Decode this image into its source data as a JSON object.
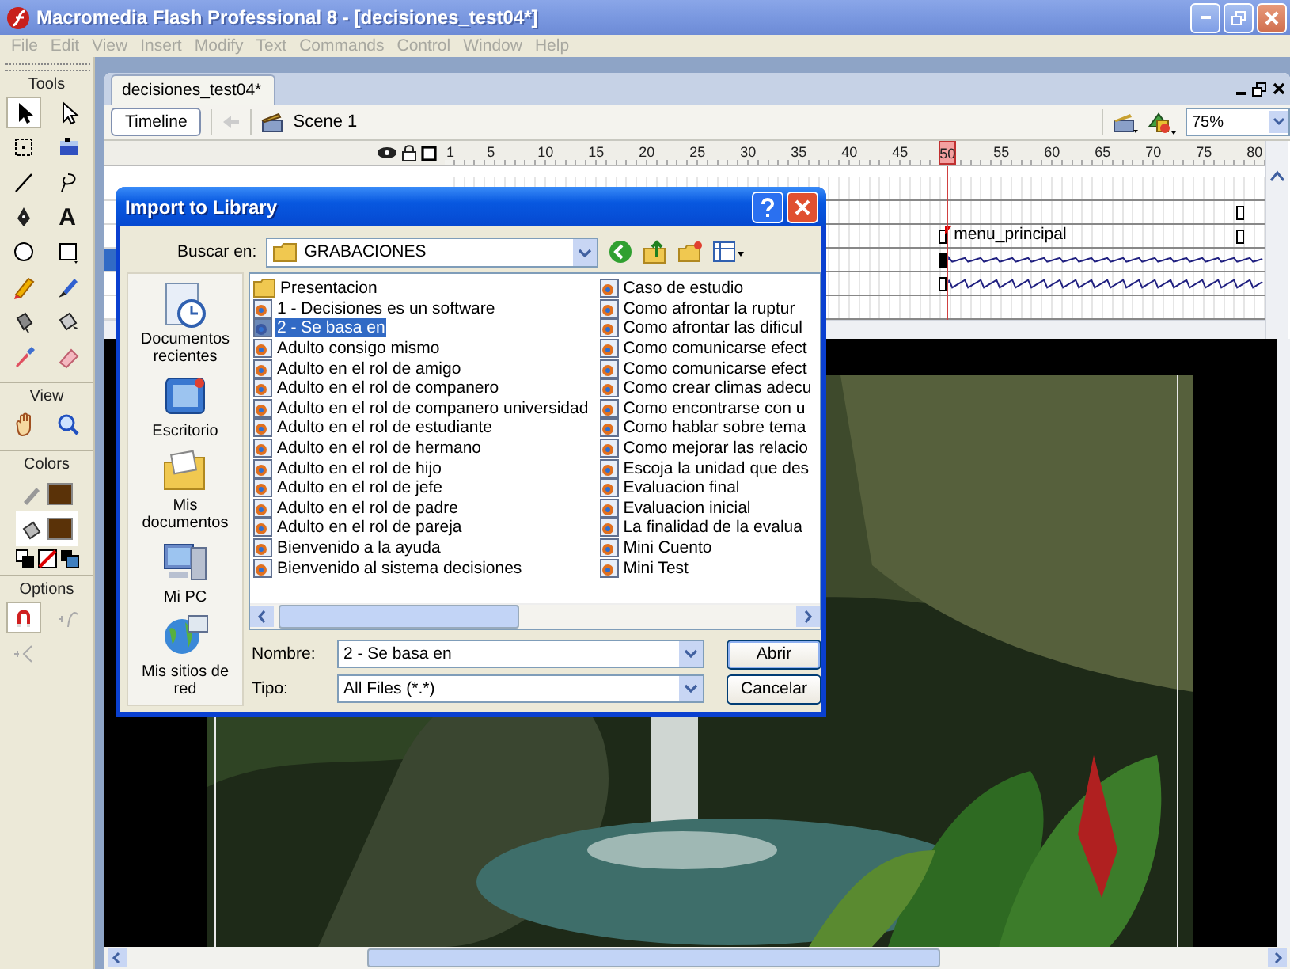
{
  "window": {
    "title": "Macromedia Flash Professional 8 - [decisiones_test04*]"
  },
  "menu": [
    {
      "label": "File",
      "disabled": true
    },
    {
      "label": "Edit",
      "disabled": true
    },
    {
      "label": "View",
      "disabled": true
    },
    {
      "label": "Insert",
      "disabled": true
    },
    {
      "label": "Modify",
      "disabled": true
    },
    {
      "label": "Text",
      "disabled": true
    },
    {
      "label": "Commands",
      "disabled": true
    },
    {
      "label": "Control",
      "disabled": true
    },
    {
      "label": "Window",
      "disabled": true
    },
    {
      "label": "Help",
      "disabled": true
    }
  ],
  "tools": {
    "title": "Tools",
    "items": [
      {
        "kind": "arrow",
        "selected": true
      },
      {
        "kind": "subselect",
        "selected": false
      },
      {
        "kind": "free-transform",
        "selected": false
      },
      {
        "kind": "gradient-transform",
        "selected": false
      },
      {
        "kind": "line",
        "selected": false
      },
      {
        "kind": "lasso",
        "selected": false
      },
      {
        "kind": "pen",
        "selected": false
      },
      {
        "kind": "text",
        "glyph": "A",
        "selected": false
      },
      {
        "kind": "oval",
        "selected": false
      },
      {
        "kind": "rectangle",
        "selected": false
      },
      {
        "kind": "pencil",
        "selected": false
      },
      {
        "kind": "brush",
        "selected": false
      },
      {
        "kind": "ink-bottle",
        "selected": false
      },
      {
        "kind": "paint-bucket",
        "selected": false
      },
      {
        "kind": "eyedropper",
        "selected": false
      },
      {
        "kind": "eraser",
        "selected": false
      }
    ],
    "view_label": "View",
    "view_items": [
      {
        "kind": "hand"
      },
      {
        "kind": "zoom"
      }
    ],
    "colors_label": "Colors",
    "options_label": "Options",
    "options": [
      {
        "kind": "snap",
        "selected": true,
        "disabled": false
      },
      {
        "kind": "smooth",
        "selected": false,
        "disabled": true
      },
      {
        "kind": "straighten",
        "selected": false,
        "disabled": true
      }
    ]
  },
  "document": {
    "tab": "decisiones_test04*",
    "timeline_button": "Timeline",
    "scene": "Scene 1",
    "zoom": "75%"
  },
  "timeline": {
    "ticks": [
      {
        "label": "1",
        "selected": false
      },
      {
        "label": "5",
        "selected": false
      },
      {
        "label": "10",
        "selected": false
      },
      {
        "label": "15",
        "selected": false
      },
      {
        "label": "20",
        "selected": false
      },
      {
        "label": "25",
        "selected": false
      },
      {
        "label": "30",
        "selected": false
      },
      {
        "label": "35",
        "selected": false
      },
      {
        "label": "40",
        "selected": false
      },
      {
        "label": "45",
        "selected": false
      },
      {
        "label": "50",
        "selected": true
      },
      {
        "label": "55",
        "selected": false
      },
      {
        "label": "60",
        "selected": false
      },
      {
        "label": "65",
        "selected": false
      },
      {
        "label": "70",
        "selected": false
      },
      {
        "label": "75",
        "selected": false
      },
      {
        "label": "80",
        "selected": false
      }
    ],
    "layers": [
      {
        "kind": "empty",
        "selected": false
      },
      {
        "kind": "end",
        "selected": false
      },
      {
        "kind": "label",
        "label": "menu_principal",
        "selected": false
      },
      {
        "kind": "sound",
        "selected": true
      },
      {
        "kind": "sound",
        "selected": false
      },
      {
        "kind": "empty",
        "selected": false
      }
    ]
  },
  "dialog": {
    "title": "Import to Library",
    "look_in_label": "Buscar en:",
    "look_in": "GRABACIONES",
    "places": [
      {
        "kind": "recent",
        "label": "Documentos recientes"
      },
      {
        "kind": "desktop",
        "label": "Escritorio"
      },
      {
        "kind": "documents",
        "label": "Mis documentos"
      },
      {
        "kind": "computer",
        "label": "Mi PC"
      },
      {
        "kind": "network",
        "label": "Mis sitios de red"
      }
    ],
    "files": [
      {
        "name": "Presentacion",
        "kind": "folder",
        "selected": false
      },
      {
        "name": "1 - Decisiones es un software",
        "kind": "flash",
        "selected": false
      },
      {
        "name": "2 - Se basa en",
        "kind": "flash",
        "selected": true
      },
      {
        "name": "Adulto consigo mismo",
        "kind": "flash",
        "selected": false
      },
      {
        "name": "Adulto en el rol de amigo",
        "kind": "flash",
        "selected": false
      },
      {
        "name": "Adulto en el rol de companero",
        "kind": "flash",
        "selected": false
      },
      {
        "name": "Adulto en el rol de companero universidad",
        "kind": "flash",
        "selected": false
      },
      {
        "name": "Adulto en el rol de estudiante",
        "kind": "flash",
        "selected": false
      },
      {
        "name": "Adulto en el rol de hermano",
        "kind": "flash",
        "selected": false
      },
      {
        "name": "Adulto en el rol de hijo",
        "kind": "flash",
        "selected": false
      },
      {
        "name": "Adulto en el rol de jefe",
        "kind": "flash",
        "selected": false
      },
      {
        "name": "Adulto en el rol de padre",
        "kind": "flash",
        "selected": false
      },
      {
        "name": "Adulto en el rol de pareja",
        "kind": "flash",
        "selected": false
      },
      {
        "name": "Bienvenido a la ayuda",
        "kind": "flash",
        "selected": false
      },
      {
        "name": "Bienvenido al sistema decisiones",
        "kind": "flash",
        "selected": false
      },
      {
        "name": "Caso de estudio",
        "kind": "flash",
        "selected": false
      },
      {
        "name": "Como afrontar la ruptur",
        "kind": "flash",
        "selected": false
      },
      {
        "name": "Como afrontar las dificul",
        "kind": "flash",
        "selected": false
      },
      {
        "name": "Como comunicarse efect",
        "kind": "flash",
        "selected": false
      },
      {
        "name": "Como comunicarse efect",
        "kind": "flash",
        "selected": false
      },
      {
        "name": "Como crear climas adecu",
        "kind": "flash",
        "selected": false
      },
      {
        "name": "Como encontrarse con u",
        "kind": "flash",
        "selected": false
      },
      {
        "name": "Como hablar sobre tema",
        "kind": "flash",
        "selected": false
      },
      {
        "name": "Como mejorar las relacio",
        "kind": "flash",
        "selected": false
      },
      {
        "name": "Escoja la unidad que des",
        "kind": "flash",
        "selected": false
      },
      {
        "name": "Evaluacion final",
        "kind": "flash",
        "selected": false
      },
      {
        "name": "Evaluacion inicial",
        "kind": "flash",
        "selected": false
      },
      {
        "name": "La finalidad de la evalua",
        "kind": "flash",
        "selected": false
      },
      {
        "name": "Mini Cuento",
        "kind": "flash",
        "selected": false
      },
      {
        "name": "Mini Test",
        "kind": "flash",
        "selected": false
      }
    ],
    "name_label": "Nombre:",
    "name_value": "2 - Se basa en",
    "type_label": "Tipo:",
    "type_value": "All Files (*.*)",
    "open_button": "Abrir",
    "cancel_button": "Cancelar"
  }
}
